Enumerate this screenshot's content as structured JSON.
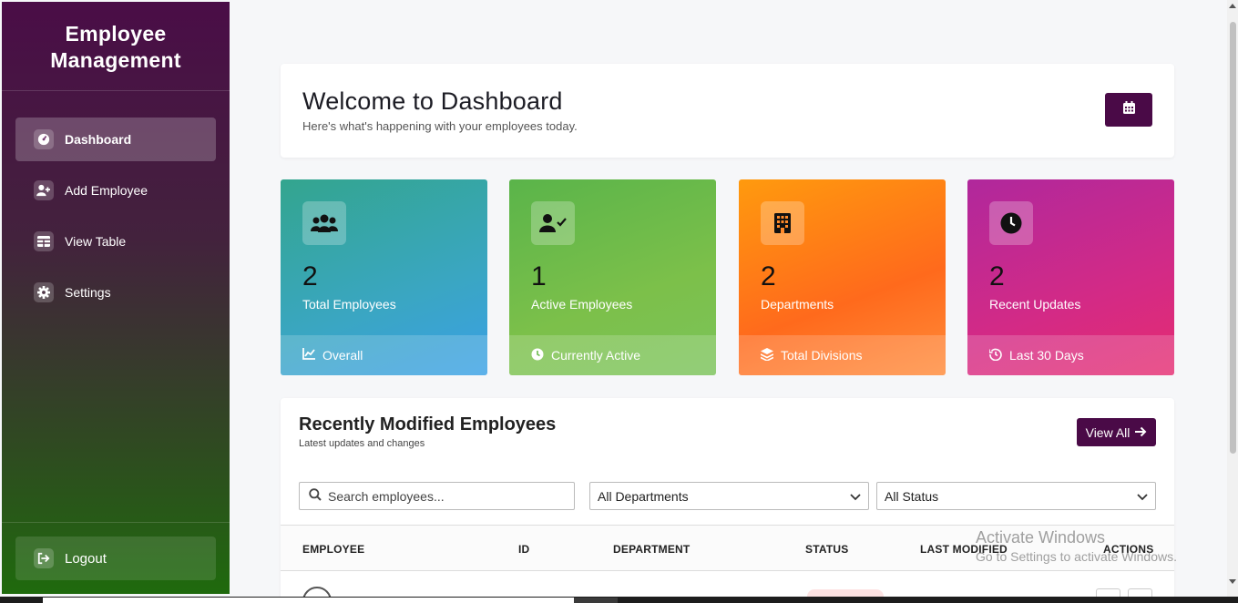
{
  "sidebar": {
    "brand_line1": "Employee",
    "brand_line2": "Management",
    "items": [
      {
        "label": "Dashboard",
        "icon": "dashboard-icon"
      },
      {
        "label": "Add Employee",
        "icon": "user-plus-icon"
      },
      {
        "label": "View Table",
        "icon": "table-icon"
      },
      {
        "label": "Settings",
        "icon": "gear-icon"
      }
    ],
    "logout_label": "Logout"
  },
  "welcome": {
    "title": "Welcome to Dashboard",
    "subtitle": "Here's what's happening with your employees today.",
    "calendar_icon": "calendar-icon"
  },
  "stats": [
    {
      "value": "2",
      "label": "Total Employees",
      "footer": "Overall",
      "icon": "users-icon",
      "footer_icon": "chart-line-icon"
    },
    {
      "value": "1",
      "label": "Active Employees",
      "footer": "Currently Active",
      "icon": "user-check-icon",
      "footer_icon": "clock-icon"
    },
    {
      "value": "2",
      "label": "Departments",
      "footer": "Total Divisions",
      "icon": "building-icon",
      "footer_icon": "layers-icon"
    },
    {
      "value": "2",
      "label": "Recent Updates",
      "footer": "Last 30 Days",
      "icon": "clock-icon",
      "footer_icon": "history-icon"
    }
  ],
  "recent": {
    "title": "Recently Modified Employees",
    "subtitle": "Latest updates and changes",
    "view_all_label": "View All",
    "search_placeholder": "Search employees...",
    "department_filter": "All Departments",
    "status_filter": "All Status",
    "columns": [
      "EMPLOYEE",
      "ID",
      "DEPARTMENT",
      "STATUS",
      "LAST MODIFIED",
      "ACTIONS"
    ]
  },
  "watermark": {
    "line1": "Activate Windows",
    "line2": "Go to Settings to activate Windows."
  },
  "colors": {
    "accent": "#4a0a47",
    "card1": "#3aa6c2",
    "card2": "#7cc04a",
    "card3": "#ff6a1c",
    "card4": "#d32a86"
  }
}
